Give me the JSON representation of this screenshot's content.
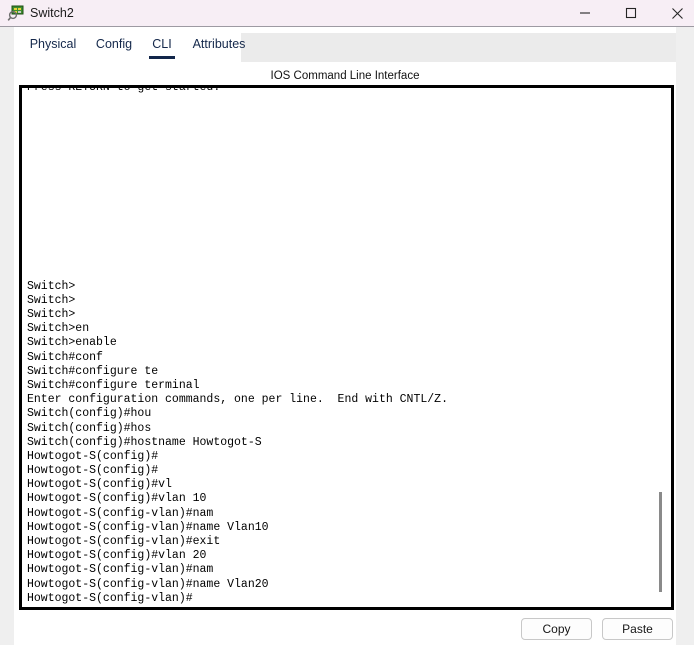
{
  "window": {
    "title": "Switch2",
    "icon": "packet-tracer-switch-icon",
    "controls": {
      "minimize": "minimize-icon",
      "maximize": "maximize-icon",
      "close": "close-icon"
    },
    "titlebar_color": "#f7eef5"
  },
  "tabs": [
    {
      "label": "Physical",
      "selected": false
    },
    {
      "label": "Config",
      "selected": false
    },
    {
      "label": "CLI",
      "selected": true
    },
    {
      "label": "Attributes",
      "selected": false
    }
  ],
  "section": {
    "header": "IOS Command Line Interface"
  },
  "terminal": {
    "accent_color": "#000000",
    "lines": [
      "Press RETURN to get started.",
      "",
      "",
      "",
      "",
      "",
      "",
      "",
      "",
      "",
      "",
      "",
      "",
      "",
      "Switch>",
      "Switch>",
      "Switch>",
      "Switch>en",
      "Switch>enable",
      "Switch#conf",
      "Switch#configure te",
      "Switch#configure terminal",
      "Enter configuration commands, one per line.  End with CNTL/Z.",
      "Switch(config)#hou",
      "Switch(config)#hos",
      "Switch(config)#hostname Howtogot-S",
      "Howtogot-S(config)#",
      "Howtogot-S(config)#",
      "Howtogot-S(config)#vl",
      "Howtogot-S(config)#vlan 10",
      "Howtogot-S(config-vlan)#nam",
      "Howtogot-S(config-vlan)#name Vlan10",
      "Howtogot-S(config-vlan)#exit",
      "Howtogot-S(config)#vlan 20",
      "Howtogot-S(config-vlan)#nam",
      "Howtogot-S(config-vlan)#name Vlan20",
      "Howtogot-S(config-vlan)#"
    ]
  },
  "actions": {
    "copy_label": "Copy",
    "paste_label": "Paste"
  }
}
